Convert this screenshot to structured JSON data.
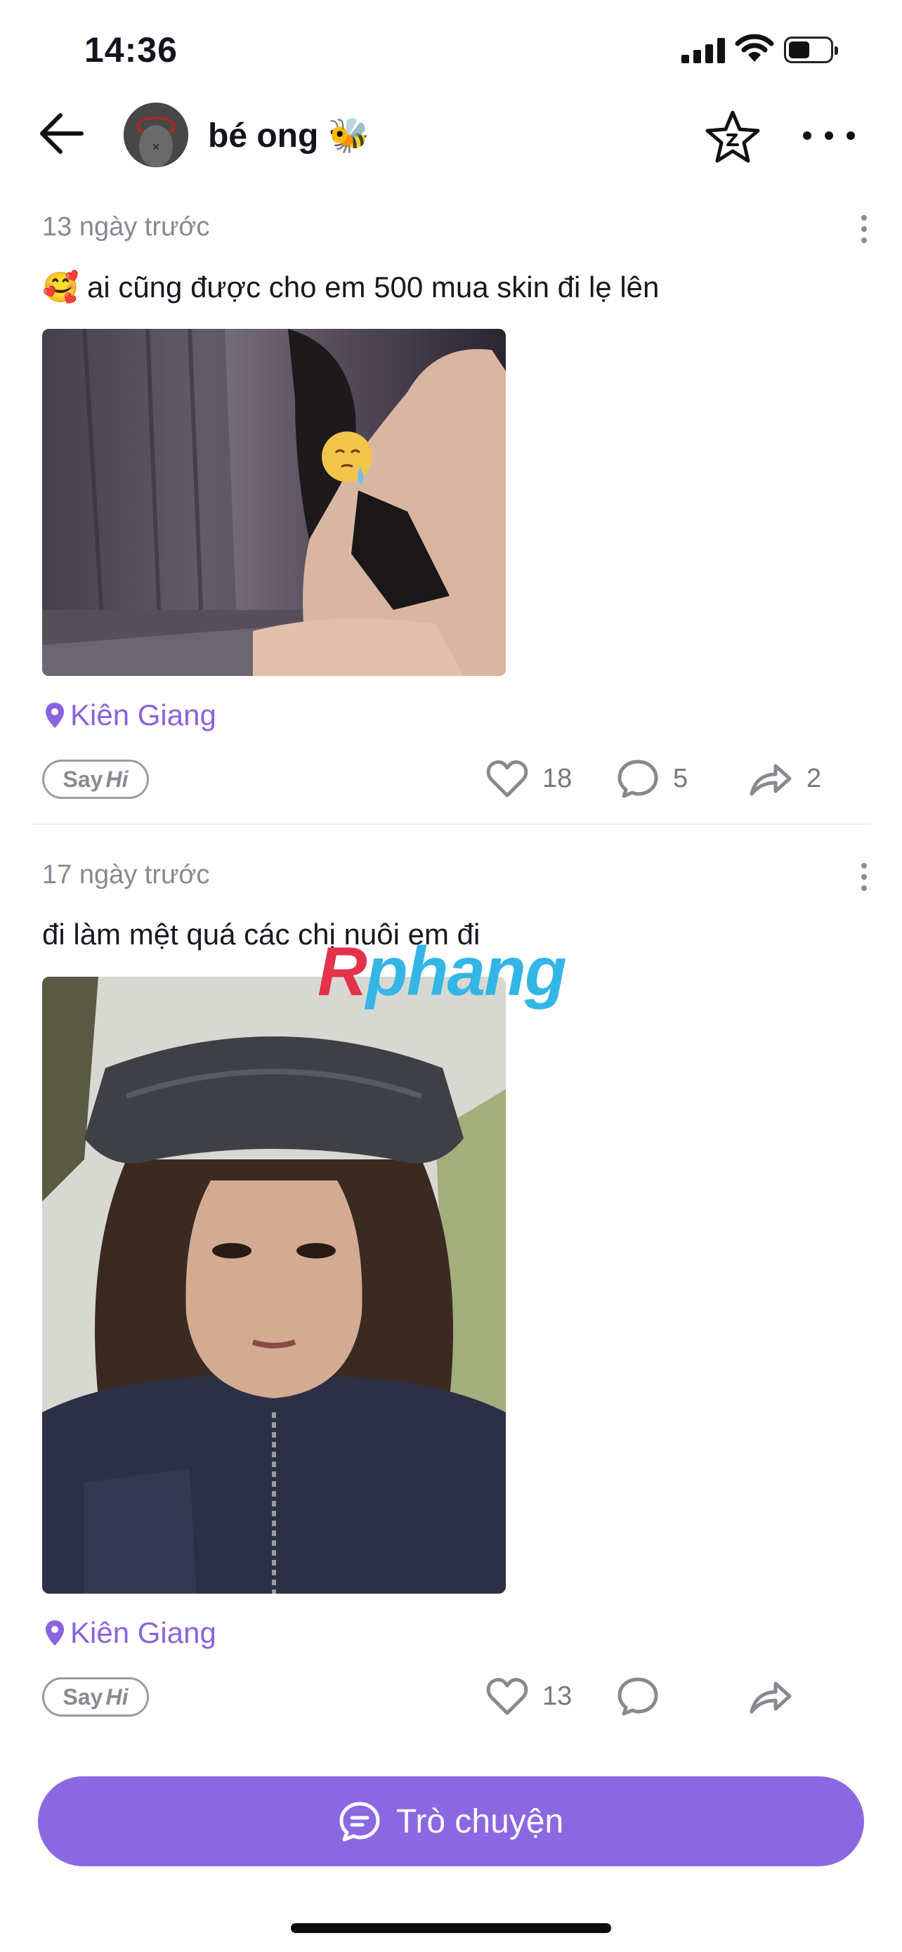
{
  "status_bar": {
    "time": "14:36"
  },
  "header": {
    "name": "bé ong 🐝"
  },
  "posts": [
    {
      "time": "13 ngày trước",
      "caption": "🥰 ai cũng được cho em 500 mua skin đi lẹ lên",
      "image_overlay_emoji": "😪",
      "location": "Kiên Giang",
      "sayhi": {
        "say": "Say",
        "hi": "Hi"
      },
      "likes": "18",
      "comments": "5",
      "shares": "2"
    },
    {
      "time": "17 ngày trước",
      "caption": "đi làm mệt quá các chị nuôi em đi",
      "location": "Kiên Giang",
      "sayhi": {
        "say": "Say",
        "hi": "Hi"
      },
      "likes": "13",
      "comments": "",
      "shares": ""
    }
  ],
  "watermark": {
    "part1": "R",
    "part2": "phang"
  },
  "cta": {
    "label": "Trò chuyện"
  },
  "colors": {
    "accent": "#8b68e2",
    "location": "#8a63e0"
  },
  "icons": [
    "back-arrow-icon",
    "star-icon",
    "more-icon",
    "location-pin-icon",
    "heart-icon",
    "comment-icon",
    "share-icon",
    "chat-icon"
  ]
}
